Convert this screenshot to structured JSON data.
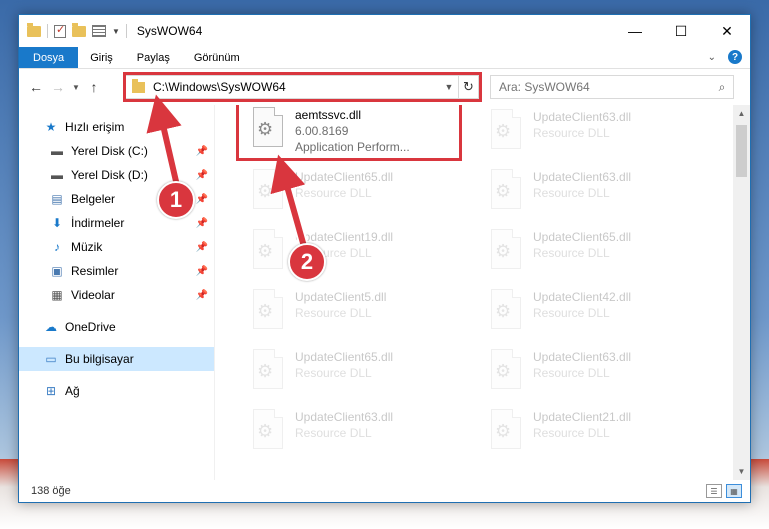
{
  "window": {
    "title": "SysWOW64",
    "controls": {
      "minimize": "—",
      "maximize": "☐",
      "close": "✕"
    }
  },
  "ribbon": {
    "tabs": [
      "Dosya",
      "Giriş",
      "Paylaş",
      "Görünüm"
    ],
    "help": "?"
  },
  "address": {
    "path": "C:\\Windows\\SysWOW64",
    "search_placeholder": "Ara: SysWOW64"
  },
  "nav": {
    "quick_access": "Hızlı erişim",
    "items": [
      "Yerel Disk (C:)",
      "Yerel Disk (D:)",
      "Belgeler",
      "İndirmeler",
      "Müzik",
      "Resimler",
      "Videolar"
    ],
    "onedrive": "OneDrive",
    "this_pc": "Bu bilgisayar",
    "network": "Ağ"
  },
  "files": {
    "highlighted": {
      "name": "aemtssvc.dll",
      "version": "6.00.8169",
      "desc": "Application Perform..."
    },
    "faded": [
      {
        "name": "UpdateClient63.dll",
        "desc": "Resource DLL"
      },
      {
        "name": "UpdateClient65.dll",
        "desc": "Resource DLL"
      },
      {
        "name": "UpdateClient63.dll",
        "desc": "Resource DLL"
      },
      {
        "name": "UpdateClient19.dll",
        "desc": "Resource DLL"
      },
      {
        "name": "UpdateClient65.dll",
        "desc": "Resource DLL"
      },
      {
        "name": "UpdateClient5.dll",
        "desc": "Resource DLL"
      },
      {
        "name": "UpdateClient42.dll",
        "desc": "Resource DLL"
      },
      {
        "name": "UpdateClient65.dll",
        "desc": "Resource DLL"
      },
      {
        "name": "UpdateClient63.dll",
        "desc": "Resource DLL"
      },
      {
        "name": "UpdateClient63.dll",
        "desc": "Resource DLL"
      },
      {
        "name": "UpdateClient21.dll",
        "desc": "Resource DLL"
      }
    ]
  },
  "status": {
    "count": "138 öğe"
  },
  "annotations": {
    "badge1": "1",
    "badge2": "2",
    "accent": "#d9363e"
  }
}
